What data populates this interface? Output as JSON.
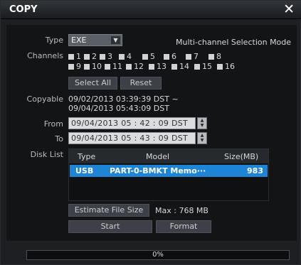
{
  "window": {
    "title": "COPY",
    "close_glyph": "✕"
  },
  "type": {
    "label": "Type",
    "value": "EXE",
    "mode_text": "Multi-channel Selection Mode"
  },
  "channels": {
    "label": "Channels",
    "row1": [
      "1",
      "2",
      "3",
      "4",
      "5",
      "6",
      "7",
      "8"
    ],
    "row2": [
      "9",
      "10",
      "11",
      "12",
      "13",
      "14",
      "15",
      "16"
    ]
  },
  "buttons": {
    "select_all": "Select All",
    "reset": "Reset",
    "estimate": "Estimate File Size",
    "start": "Start",
    "format": "Format"
  },
  "copyable": {
    "label": "Copyable",
    "line1": "09/02/2013  03:39:39  DST ~",
    "line2": "09/04/2013  05:43:09  DST"
  },
  "from": {
    "label": "From",
    "value": "09/04/2013  05 : 42 : 09   DST"
  },
  "to": {
    "label": "To",
    "value": "09/04/2013  05 : 43 : 09   DST"
  },
  "disk_list": {
    "label": "Disk List",
    "columns": [
      "Type",
      "Model",
      "Size(MB)"
    ],
    "rows": [
      {
        "type": "USB",
        "model": "PART-0-BMKT Memo···",
        "size": "983"
      }
    ]
  },
  "max_text": "Max : 768 MB",
  "progress": {
    "percent_text": "0%",
    "fraction": 0.0
  },
  "colors": {
    "accent": "#1e84d6",
    "background": "#131416"
  }
}
